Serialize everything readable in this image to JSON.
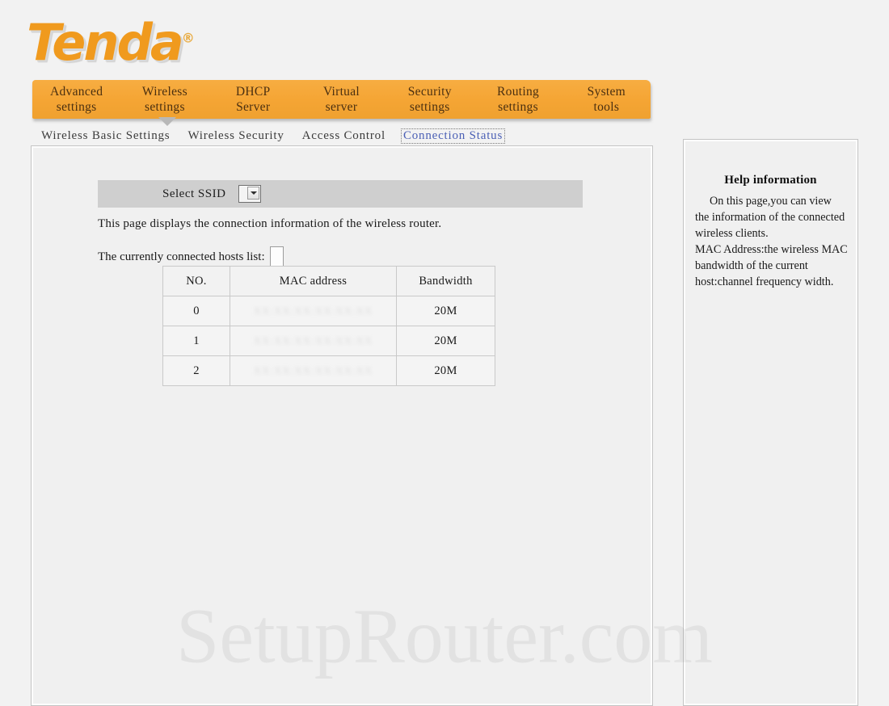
{
  "brand": {
    "name": "Tenda",
    "registered_mark": "®",
    "color": "#f09a1e"
  },
  "main_nav": {
    "accent_color": "#f5a534",
    "active_index": 1,
    "items": [
      {
        "line1": "Advanced",
        "line2": "settings"
      },
      {
        "line1": "Wireless",
        "line2": "settings"
      },
      {
        "line1": "DHCP",
        "line2": "Server"
      },
      {
        "line1": "Virtual",
        "line2": "server"
      },
      {
        "line1": "Security",
        "line2": "settings"
      },
      {
        "line1": "Routing",
        "line2": "settings"
      },
      {
        "line1": "System",
        "line2": "tools"
      }
    ]
  },
  "sub_nav": {
    "active_color": "#4a5fb5",
    "items": [
      {
        "label": "Wireless Basic Settings",
        "active": false
      },
      {
        "label": "Wireless Security",
        "active": false
      },
      {
        "label": "Access Control",
        "active": false
      },
      {
        "label": "Connection Status",
        "active": true
      }
    ]
  },
  "main": {
    "ssid": {
      "label": "Select SSID",
      "selected": "",
      "options": []
    },
    "description": "This page displays the connection information of the wireless router.",
    "hosts_list_label": "The currently connected hosts list:",
    "hosts_list_value": "",
    "table": {
      "headers": [
        "NO.",
        "MAC address",
        "Bandwidth"
      ],
      "rows": [
        {
          "no": "0",
          "mac": "",
          "mac_redacted": "XX:XX:XX:XX:XX:XX",
          "bandwidth": "20M"
        },
        {
          "no": "1",
          "mac": "",
          "mac_redacted": "XX:XX:XX:XX:XX:XX",
          "bandwidth": "20M"
        },
        {
          "no": "2",
          "mac": "",
          "mac_redacted": "XX:XX:XX:XX:XX:XX",
          "bandwidth": "20M"
        }
      ]
    }
  },
  "help": {
    "title": "Help information",
    "paragraph1": "On this page,you can view the information of the connected wireless clients.",
    "paragraph2": "MAC Address:the wireless MAC bandwidth of the current host:channel frequency width."
  },
  "watermark": {
    "text": "SetupRouter.com"
  }
}
